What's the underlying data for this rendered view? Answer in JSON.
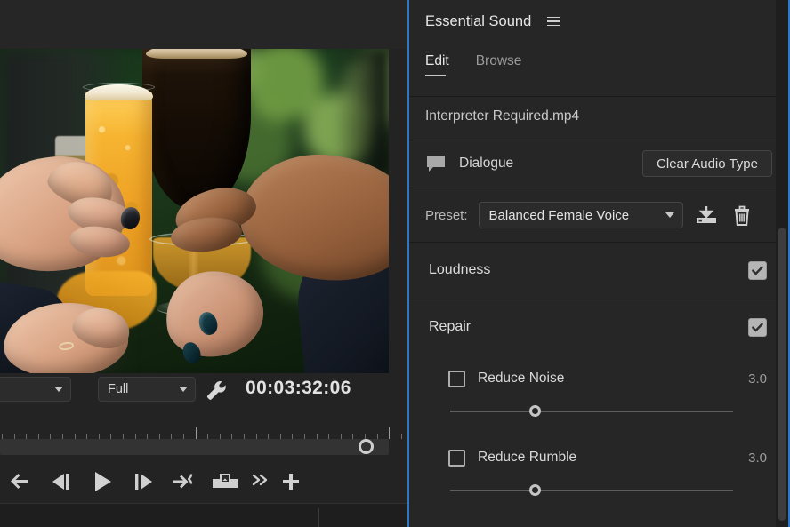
{
  "monitor": {
    "name": "program-monitor",
    "fit_dropdown": {
      "value": "",
      "icon": "chevron-down-icon"
    },
    "resolution_dropdown": {
      "value": "Full",
      "icon": "chevron-down-icon"
    },
    "settings_icon": "wrench-icon",
    "timecode": "00:03:32:06",
    "transport": [
      {
        "name": "go-to-in-point-button",
        "icon": "arrow-left-icon",
        "label": "Go to In Point"
      },
      {
        "name": "step-back-button",
        "icon": "step-back-icon",
        "label": "Step Back 1 Frame"
      },
      {
        "name": "play-stop-button",
        "icon": "play-icon",
        "label": "Play-Stop Toggle"
      },
      {
        "name": "step-forward-button",
        "icon": "step-forward-icon",
        "label": "Step Forward 1 Frame"
      },
      {
        "name": "go-to-out-point-button",
        "icon": "arrow-to-out-icon",
        "label": "Go to Out Point"
      },
      {
        "name": "export-frame-button",
        "icon": "camera-icon",
        "label": "Export Frame"
      },
      {
        "name": "button-editor-overflow",
        "icon": "double-chevron-right-icon",
        "label": "More"
      },
      {
        "name": "button-editor-add",
        "icon": "plus-icon",
        "label": "Button Editor"
      }
    ],
    "playhead": {
      "name": "playhead-marker",
      "position_pct": 94
    }
  },
  "essential_sound": {
    "title": "Essential Sound",
    "menu_icon": "hamburger-menu-icon",
    "tabs": [
      {
        "label": "Edit",
        "active": true
      },
      {
        "label": "Browse",
        "active": false
      }
    ],
    "filename": "Interpreter Required.mp4",
    "clip": {
      "type_icon": "speech-bubble-icon",
      "type_label": "Dialogue",
      "clear_button": "Clear Audio Type"
    },
    "preset": {
      "label": "Preset:",
      "value": "Balanced Female Voice",
      "dropdown_icon": "chevron-down-icon",
      "save_icon": "save-preset-icon",
      "delete_icon": "trash-icon"
    },
    "sections": [
      {
        "name": "loudness",
        "title": "Loudness",
        "checked": true
      },
      {
        "name": "repair",
        "title": "Repair",
        "checked": true
      }
    ],
    "parameters": [
      {
        "name": "reduce-noise",
        "label": "Reduce Noise",
        "checked": false,
        "value": "3.0",
        "slider_pct": 30
      },
      {
        "name": "reduce-rumble",
        "label": "Reduce Rumble",
        "checked": false,
        "value": "3.0",
        "slider_pct": 30
      }
    ],
    "accent_color": "#2b79c6",
    "panel_bg": "#262626",
    "scrollbar": {
      "name": "panel-scrollbar"
    }
  }
}
